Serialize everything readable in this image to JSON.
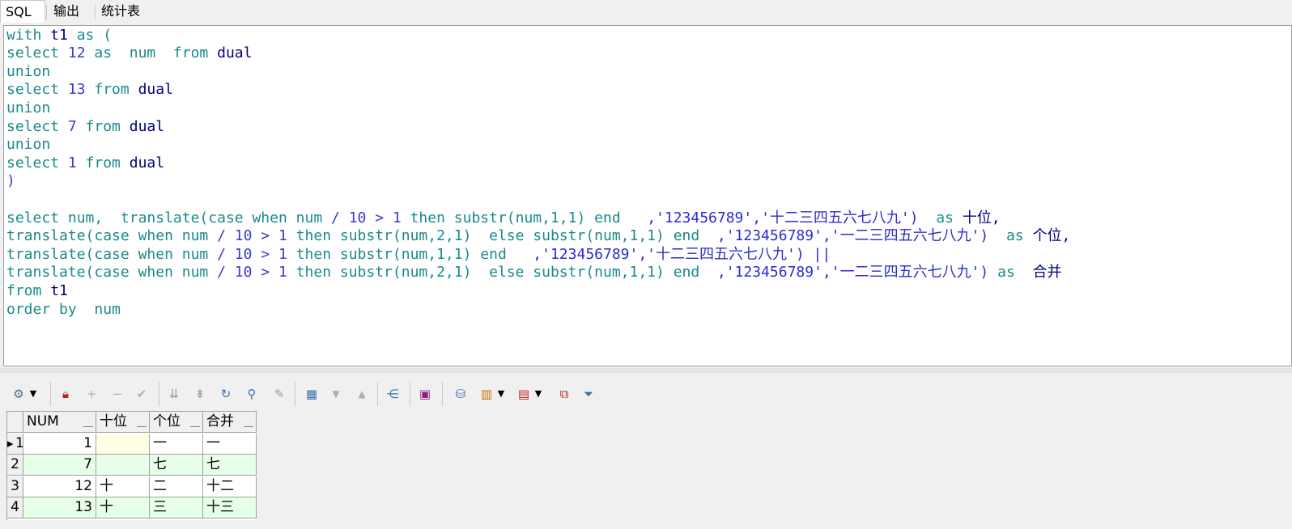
{
  "tabs": [
    {
      "label": "SQL",
      "active": true
    },
    {
      "label": "输出",
      "active": false
    },
    {
      "label": "统计表",
      "active": false
    }
  ],
  "editor": {
    "lines": [
      [
        {
          "t": "with ",
          "c": "kw"
        },
        {
          "t": "t1 ",
          "c": "id"
        },
        {
          "t": "as (",
          "c": "kw"
        }
      ],
      [
        {
          "t": "select ",
          "c": "kw"
        },
        {
          "t": "12 ",
          "c": "nm"
        },
        {
          "t": "as  ",
          "c": "kw"
        },
        {
          "t": "num  ",
          "c": "kw"
        },
        {
          "t": "from ",
          "c": "kw"
        },
        {
          "t": "dual",
          "c": "id"
        }
      ],
      [
        {
          "t": "union",
          "c": "kw"
        }
      ],
      [
        {
          "t": "select ",
          "c": "kw"
        },
        {
          "t": "13 ",
          "c": "nm"
        },
        {
          "t": "from ",
          "c": "kw"
        },
        {
          "t": "dual",
          "c": "id"
        }
      ],
      [
        {
          "t": "union",
          "c": "kw"
        }
      ],
      [
        {
          "t": "select ",
          "c": "kw"
        },
        {
          "t": "7 ",
          "c": "nm"
        },
        {
          "t": "from ",
          "c": "kw"
        },
        {
          "t": "dual",
          "c": "id"
        }
      ],
      [
        {
          "t": "union",
          "c": "kw"
        }
      ],
      [
        {
          "t": "select ",
          "c": "kw"
        },
        {
          "t": "1 ",
          "c": "nm"
        },
        {
          "t": "from ",
          "c": "kw"
        },
        {
          "t": "dual",
          "c": "id"
        }
      ],
      [
        {
          "t": ")",
          "c": "op"
        }
      ],
      [],
      [
        {
          "t": "select ",
          "c": "kw"
        },
        {
          "t": "num,  ",
          "c": "kw"
        },
        {
          "t": "translate(",
          "c": "kw"
        },
        {
          "t": "case ",
          "c": "kw"
        },
        {
          "t": "when ",
          "c": "kw"
        },
        {
          "t": "num ",
          "c": "kw"
        },
        {
          "t": "/ ",
          "c": "op"
        },
        {
          "t": "10 ",
          "c": "nm"
        },
        {
          "t": "> ",
          "c": "op"
        },
        {
          "t": "1 ",
          "c": "nm"
        },
        {
          "t": "then ",
          "c": "kw"
        },
        {
          "t": "substr(num,1,1) ",
          "c": "kw"
        },
        {
          "t": "end   ",
          "c": "kw"
        },
        {
          "t": ",'123456789','十二三四五六七八九')  ",
          "c": "st"
        },
        {
          "t": "as ",
          "c": "kw"
        },
        {
          "t": "十位,",
          "c": "id"
        }
      ],
      [
        {
          "t": "translate(",
          "c": "kw"
        },
        {
          "t": "case ",
          "c": "kw"
        },
        {
          "t": "when ",
          "c": "kw"
        },
        {
          "t": "num ",
          "c": "kw"
        },
        {
          "t": "/ ",
          "c": "op"
        },
        {
          "t": "10 ",
          "c": "nm"
        },
        {
          "t": "> ",
          "c": "op"
        },
        {
          "t": "1 ",
          "c": "nm"
        },
        {
          "t": "then ",
          "c": "kw"
        },
        {
          "t": "substr(num,2,1)  ",
          "c": "kw"
        },
        {
          "t": "else ",
          "c": "kw"
        },
        {
          "t": "substr(num,1,1) ",
          "c": "kw"
        },
        {
          "t": "end  ",
          "c": "kw"
        },
        {
          "t": ",'123456789','一二三四五六七八九')  ",
          "c": "st"
        },
        {
          "t": "as ",
          "c": "kw"
        },
        {
          "t": "个位,",
          "c": "id"
        }
      ],
      [
        {
          "t": "translate(",
          "c": "kw"
        },
        {
          "t": "case ",
          "c": "kw"
        },
        {
          "t": "when ",
          "c": "kw"
        },
        {
          "t": "num ",
          "c": "kw"
        },
        {
          "t": "/ ",
          "c": "op"
        },
        {
          "t": "10 ",
          "c": "nm"
        },
        {
          "t": "> ",
          "c": "op"
        },
        {
          "t": "1 ",
          "c": "nm"
        },
        {
          "t": "then ",
          "c": "kw"
        },
        {
          "t": "substr(num,1,1) ",
          "c": "kw"
        },
        {
          "t": "end   ",
          "c": "kw"
        },
        {
          "t": ",'123456789','十二三四五六七八九') ||",
          "c": "st"
        }
      ],
      [
        {
          "t": "translate(",
          "c": "kw"
        },
        {
          "t": "case ",
          "c": "kw"
        },
        {
          "t": "when ",
          "c": "kw"
        },
        {
          "t": "num ",
          "c": "kw"
        },
        {
          "t": "/ ",
          "c": "op"
        },
        {
          "t": "10 ",
          "c": "nm"
        },
        {
          "t": "> ",
          "c": "op"
        },
        {
          "t": "1 ",
          "c": "nm"
        },
        {
          "t": "then ",
          "c": "kw"
        },
        {
          "t": "substr(num,2,1)  ",
          "c": "kw"
        },
        {
          "t": "else ",
          "c": "kw"
        },
        {
          "t": "substr(num,1,1) ",
          "c": "kw"
        },
        {
          "t": "end  ",
          "c": "kw"
        },
        {
          "t": ",'123456789','一二三四五六七八九') ",
          "c": "st"
        },
        {
          "t": "as  ",
          "c": "kw"
        },
        {
          "t": "合并",
          "c": "id"
        }
      ],
      [
        {
          "t": "from ",
          "c": "kw"
        },
        {
          "t": "t1",
          "c": "id"
        }
      ],
      [
        {
          "t": "order ",
          "c": "kw"
        },
        {
          "t": "by  ",
          "c": "kw"
        },
        {
          "t": "num",
          "c": "kw"
        }
      ]
    ]
  },
  "toolbar": {
    "icons": [
      "tools-menu-icon",
      "lock-icon",
      "insert-record-icon",
      "delete-record-icon",
      "post-changes-icon",
      "first-record-icon",
      "last-record-icon",
      "refresh-icon",
      "find-icon",
      "clear-icon",
      "single-record-view-icon",
      "next-page-icon",
      "previous-page-icon",
      "query-by-example-icon",
      "save-icon",
      "connect-icon",
      "chart-icon",
      "export-grid-icon",
      "copy-grid-icon",
      "filter-icon"
    ]
  },
  "grid": {
    "columns": [
      "NUM",
      "十位",
      "个位",
      "合并"
    ],
    "rows": [
      {
        "index": "1",
        "cells": [
          "1",
          "",
          "一",
          "一"
        ]
      },
      {
        "index": "2",
        "cells": [
          "7",
          "",
          "七",
          "七"
        ]
      },
      {
        "index": "3",
        "cells": [
          "12",
          "十",
          "二",
          "十二"
        ]
      },
      {
        "index": "4",
        "cells": [
          "13",
          "十",
          "三",
          "十三"
        ]
      }
    ],
    "current_row": 1
  },
  "colors": {
    "keyword": "#1a8a8a",
    "identifier": "#000080",
    "number": "#3b3bd4",
    "string": "#2b2bd0",
    "alt_row": "#e6ffe6",
    "selected_cell": "#ffffe6"
  }
}
